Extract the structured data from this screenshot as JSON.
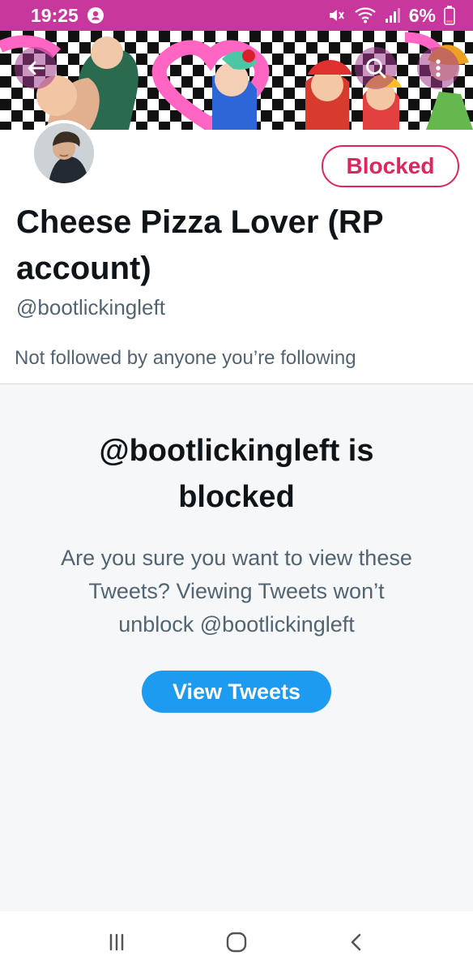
{
  "status_bar": {
    "time": "19:25",
    "battery": "6%",
    "icons": [
      "profile-dot-icon",
      "mute-icon",
      "wifi-icon",
      "signal-icon",
      "battery-icon"
    ]
  },
  "header": {
    "back_icon": "arrow-left-icon",
    "search_icon": "search-icon",
    "more_icon": "more-vertical-icon"
  },
  "profile": {
    "name": "Cheese Pizza Lover (RP account)",
    "handle": "@bootlickingleft",
    "status_button": "Blocked",
    "followers_note": "Not followed by anyone you’re following"
  },
  "blocked_notice": {
    "title": "@bootlickingleft is blocked",
    "description": "Are you sure you want to view these Tweets? Viewing Tweets won’t unblock @bootlickingleft",
    "button": "View Tweets"
  },
  "navigation": {
    "icons": [
      "recent-apps-icon",
      "home-icon",
      "back-icon"
    ]
  },
  "colors": {
    "status_bar": "#c8379b",
    "blocked_red": "#e0245e",
    "twitter_blue": "#1d9bf0",
    "panel_bg": "#f5f7f8",
    "secondary_text": "#536471"
  }
}
